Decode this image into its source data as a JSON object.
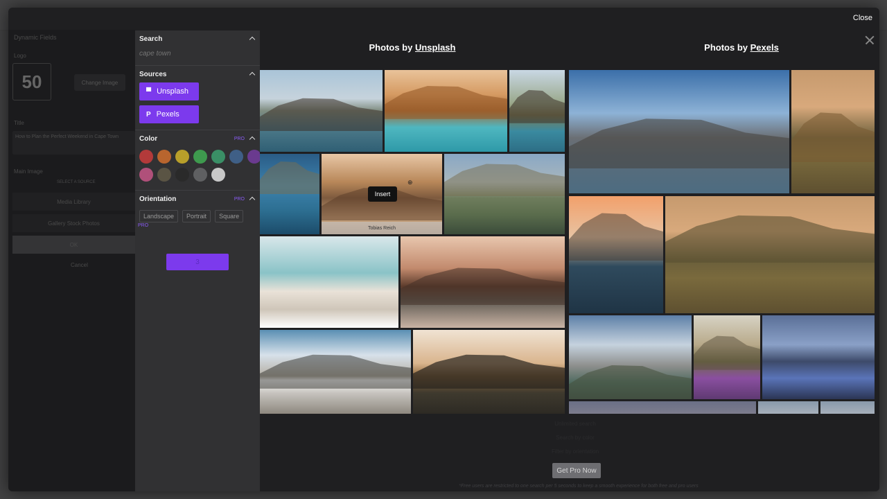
{
  "modal": {
    "close_label": "Close"
  },
  "background_form": {
    "section_title": "Dynamic Fields",
    "logo_label": "Logo",
    "logo_text": "50",
    "change_image_label": "Change Image",
    "title_label": "Title",
    "title_value": "How to Plan the Perfect Weekend in Cape Town",
    "main_image_label": "Main Image",
    "select_label": "SELECT A SOURCE",
    "media_library_label": "Media Library",
    "gallery_label": "Gallery Stock Photos",
    "ok_label": "OK",
    "cancel_label": "Cancel"
  },
  "sidebar": {
    "search": {
      "title": "Search",
      "placeholder": "cape town"
    },
    "sources": {
      "title": "Sources",
      "items": [
        {
          "label": "Unsplash",
          "icon": "unsplash-icon"
        },
        {
          "label": "Pexels",
          "icon": "pexels-icon"
        }
      ]
    },
    "color": {
      "title": "Color",
      "pro_badge": "PRO",
      "swatches": [
        "#b33a3a",
        "#b8652e",
        "#b89f2a",
        "#3e9a4e",
        "#3a8f66",
        "#3f5f86",
        "#6a3a8f",
        "#b0507a",
        "#5a5444",
        "#2a2a2a",
        "#5f6062",
        "#c8c8c8"
      ]
    },
    "orientation": {
      "title": "Orientation",
      "pro_badge": "PRO",
      "options": [
        "Landscape",
        "Portrait",
        "Square"
      ],
      "pro_note": "PRO"
    },
    "load_more_label": "3"
  },
  "main": {
    "unsplash_title_prefix": "Photos by ",
    "unsplash_link": "Unsplash",
    "pexels_title_prefix": "Photos by ",
    "pexels_link": "Pexels",
    "tooltip_label": "Insert",
    "author_caption": "Tobias Reich",
    "zoom_icon": "zoom-in-icon",
    "promo_line1": "Unlimited search",
    "promo_line2": "Search by color",
    "promo_line3": "Filter by orientation",
    "get_pro_label": "Get Pro Now",
    "footnote": "*Free users are restricted to one search per 5 seconds to keep a smooth experience for both free and pro users"
  }
}
